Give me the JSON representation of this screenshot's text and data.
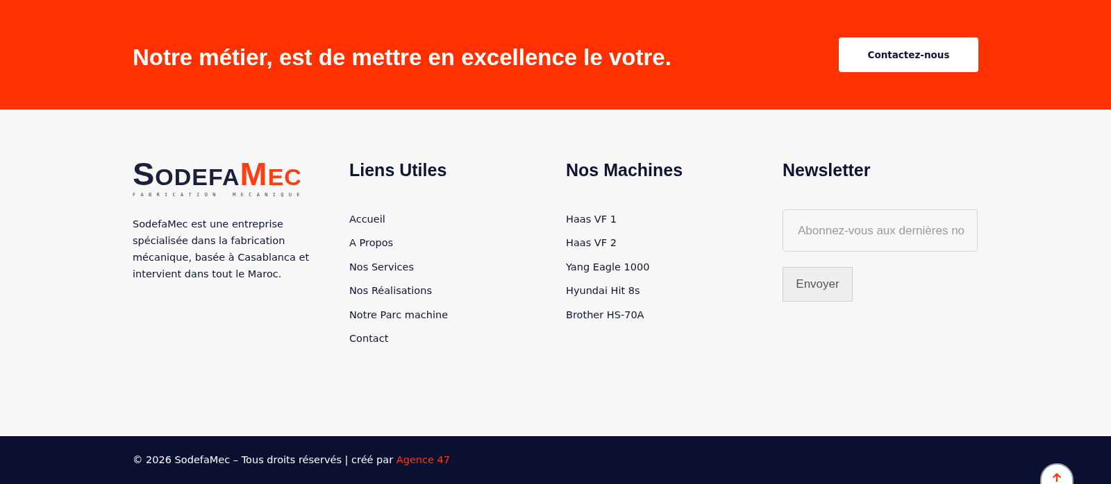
{
  "banner": {
    "heading": "Notre métier, est de mettre en excellence le votre.",
    "button": "Contactez-nous"
  },
  "brand": {
    "wordmark_main": "SODEFA",
    "wordmark_accent": "MEC",
    "tagline": "FABRICATION MECANIQUE",
    "description": "SodefaMec est une entreprise spécialisée dans la fabrication mécanique, basée à Casablanca et intervient dans tout le Maroc."
  },
  "link_columns": [
    {
      "heading": "Liens Utiles",
      "links": [
        "Accueil",
        "A Propos",
        "Nos Services",
        "Nos Réalisations",
        "Notre Parc machine",
        "Contact"
      ]
    },
    {
      "heading": "Nos Machines",
      "links": [
        "Haas VF 1",
        "Haas VF 2",
        "Yang Eagle 1000",
        "Hyundai Hit 8s",
        "Brother HS-70A"
      ]
    }
  ],
  "newsletter": {
    "heading": "Newsletter",
    "placeholder": "Abonnez-vous aux dernières no",
    "button": "Envoyer"
  },
  "bottom_bar": {
    "copyright": "© 2026 SodefaMec – Tous droits réservés | créé par",
    "credit_link": "Agence 47"
  }
}
